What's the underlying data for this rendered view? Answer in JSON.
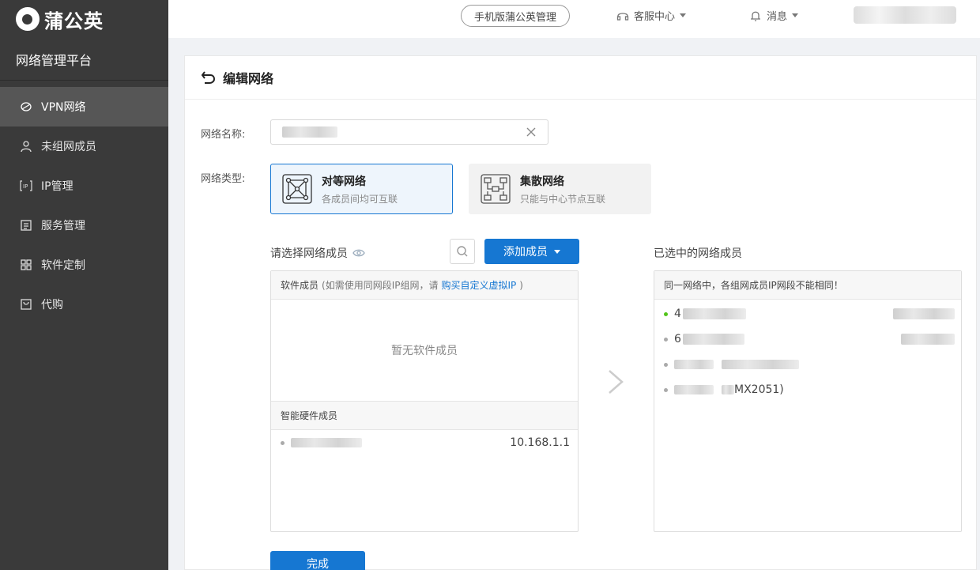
{
  "brand": {
    "name": "蒲公英",
    "platform": "网络管理平台"
  },
  "sidebar": {
    "items": [
      {
        "label": "VPN网络",
        "icon": "vpn-icon",
        "active": true
      },
      {
        "label": "未组网成员",
        "icon": "user-icon",
        "active": false
      },
      {
        "label": "IP管理",
        "icon": "ip-icon",
        "active": false
      },
      {
        "label": "服务管理",
        "icon": "list-icon",
        "active": false
      },
      {
        "label": "软件定制",
        "icon": "apps-icon",
        "active": false
      },
      {
        "label": "代购",
        "icon": "bag-icon",
        "active": false
      }
    ]
  },
  "topbar": {
    "mobile_label": "手机版蒲公英管理",
    "service_label": "客服中心",
    "message_label": "消息"
  },
  "page": {
    "title": "编辑网络",
    "name_label": "网络名称:",
    "type_label": "网络类型:",
    "types": [
      {
        "name": "对等网络",
        "desc": "各成员间均可互联",
        "selected": true
      },
      {
        "name": "集散网络",
        "desc": "只能与中心节点互联",
        "selected": false
      }
    ]
  },
  "left_panel": {
    "title": "请选择网络成员",
    "add_label": "添加成员",
    "software_head": "软件成员",
    "software_hint_pre": "(如需使用同网段IP组网，请",
    "software_hint_link": "购买自定义虚拟IP",
    "software_hint_post": ")",
    "empty_text": "暂无软件成员",
    "hardware_head": "智能硬件成员",
    "hardware_rows": [
      {
        "ip": "10.168.1.1"
      }
    ]
  },
  "right_panel": {
    "title": "已选中的网络成员",
    "notice": "同一网络中，各组网成员IP网段不能相同！",
    "rows": [
      {
        "prefix": "4",
        "online": true
      },
      {
        "prefix": "6",
        "online": false
      },
      {
        "prefix": "",
        "online": false
      },
      {
        "prefix": "",
        "suffix": "MX2051)",
        "online": false
      }
    ]
  },
  "done_label": "完成",
  "colors": {
    "primary": "#1677d2",
    "sidebar": "#3a3a3a",
    "online": "#52c41a"
  }
}
